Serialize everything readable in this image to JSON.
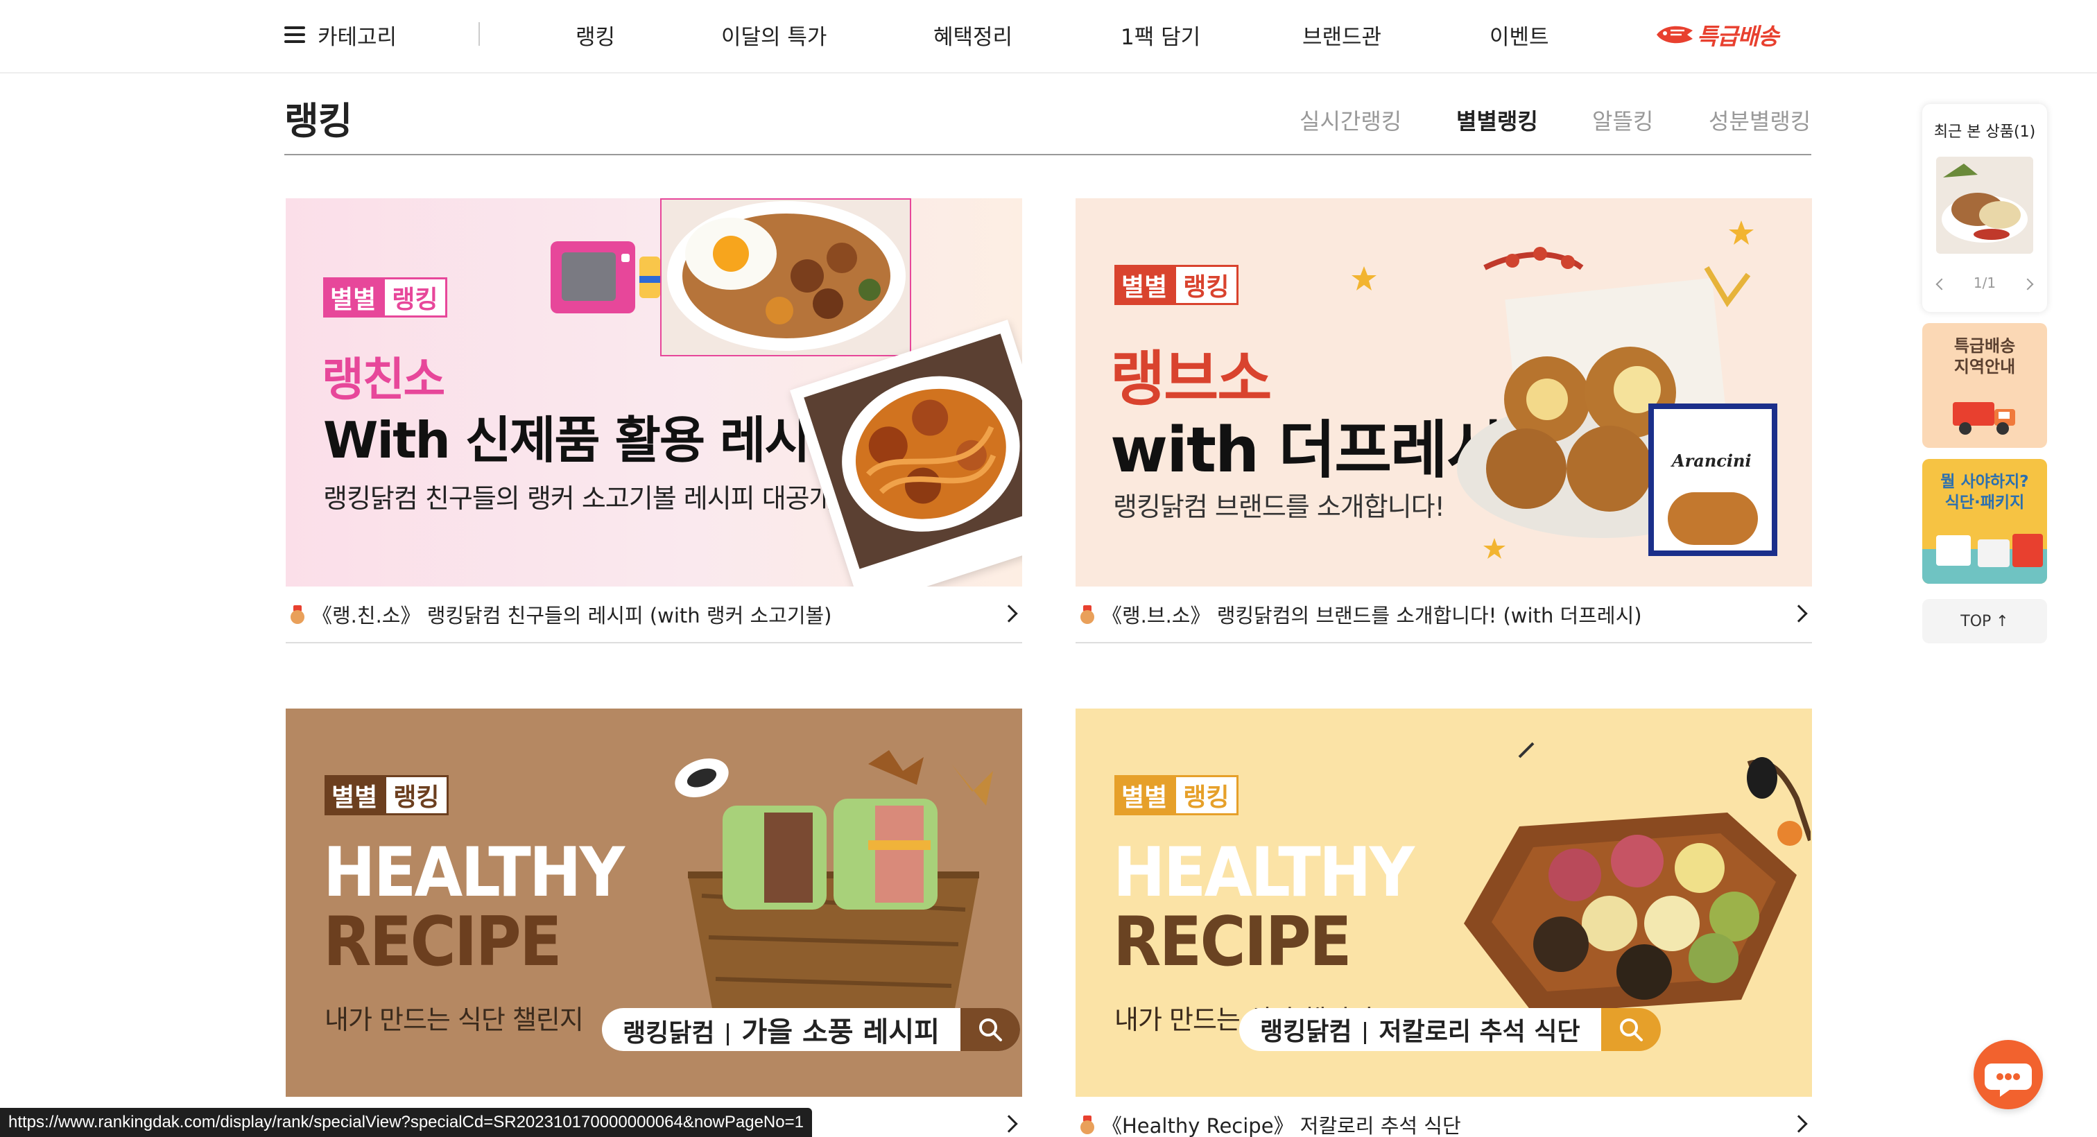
{
  "gnb": {
    "category_label": "카테고리",
    "items": [
      "랭킹",
      "이달의 특가",
      "혜택정리",
      "1팩 담기",
      "브랜드관",
      "이벤트"
    ],
    "express_label": "특급배송"
  },
  "ranking": {
    "title": "랭킹",
    "tabs": [
      "실시간랭킹",
      "별별랭킹",
      "알뜰킹",
      "성분별랭킹"
    ],
    "active_tab": "별별랭킹"
  },
  "cards": [
    {
      "badge_a": "별별",
      "badge_b": "랭킹",
      "headline": "랭친소",
      "title": "With 신제품 활용 레시피",
      "subtitle": "랭킹닭컴 친구들의 랭커 소고기볼 레시피 대공개!",
      "caption": "《랭.친.소》 랭킹닭컴 친구들의 레시피 (with 랭커 소고기볼)"
    },
    {
      "badge_a": "별별",
      "badge_b": "랭킹",
      "headline": "랭브소",
      "title": "with 더프레시",
      "subtitle": "랭킹닭컴 브랜드를 소개합니다!",
      "package_label": "Arancini",
      "caption": "《랭.브.소》 랭킹닭컴의 브랜드를 소개합니다! (with 더프레시)"
    },
    {
      "badge_a": "별별",
      "badge_b": "랭킹",
      "line1": "HEALTHY",
      "line2": "RECIPE",
      "subtitle": "내가 만드는 식단 챌린지",
      "pill_brand": "랭킹닭컴",
      "pill_title": "가을 소풍 레시피",
      "caption": ""
    },
    {
      "badge_a": "별별",
      "badge_b": "랭킹",
      "line1": "HEALTHY",
      "line2": "RECIPE",
      "subtitle": "내가 만드는 식단 챌린지",
      "pill_brand": "랭킹닭컴",
      "pill_title": "저칼로리 추석 식단",
      "caption": "《Healthy Recipe》 저칼로리 추석 식단"
    }
  ],
  "quick": {
    "recent_title": "최근 본 상품(1)",
    "pager": "1/1",
    "express_area": "특급배송\n지역안내",
    "package_promo": "뭘 사야하지?\n식단·패키지",
    "top_label": "TOP ↑"
  },
  "status_url": "https://www.rankingdak.com/display/rank/specialView?specialCd=SR202310170000000064&nowPageNo=1",
  "colors": {
    "brand_red": "#e8402f",
    "pink": "#e7479a",
    "card2_red": "#d9432e",
    "brown": "#7a4a26",
    "yellow_accent": "#e6a02a"
  }
}
